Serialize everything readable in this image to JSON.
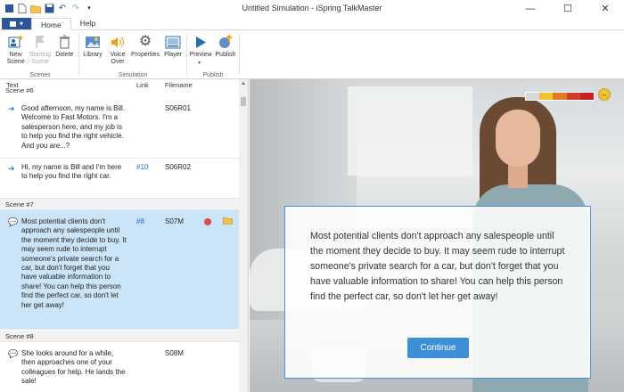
{
  "window": {
    "title": "Untitled Simulation - iSpring TalkMaster",
    "minimize": "—",
    "maximize": "☐",
    "close": "✕"
  },
  "quick_access": {
    "app_button": "▾"
  },
  "tabs": [
    {
      "label": "Home",
      "active": true
    },
    {
      "label": "Help",
      "active": false
    }
  ],
  "ribbon": {
    "groups": [
      {
        "label": "Scenes",
        "buttons": [
          {
            "label": "New\nScene",
            "icon": "new-scene-icon"
          },
          {
            "label": "Starting\nScene",
            "icon": "flag-icon",
            "disabled": true
          },
          {
            "label": "Delete",
            "icon": "trash-icon"
          }
        ]
      },
      {
        "label": "Simulation",
        "buttons": [
          {
            "label": "Library",
            "icon": "library-icon"
          },
          {
            "label": "Voice\nOver",
            "icon": "speaker-icon"
          },
          {
            "label": "Properties",
            "icon": "gear-icon"
          },
          {
            "label": "Player",
            "icon": "player-icon"
          }
        ]
      },
      {
        "label": "Publish",
        "buttons": [
          {
            "label": "Preview",
            "icon": "play-icon"
          },
          {
            "label": "Publish",
            "icon": "publish-icon"
          }
        ]
      }
    ]
  },
  "scene_list": {
    "columns": {
      "text": "Text",
      "link": "Link",
      "filename": "Filename"
    },
    "partial_header": "Scene #6",
    "rows_scene6": [
      {
        "text": "Good afternoon, my name is Bill. Welcome to Fast Motors. I'm a salesperson here, and my job is to help you find the right vehicle. And you are...?",
        "link": "",
        "filename": "S06R01"
      },
      {
        "text": "Hi, my name is Bill and I'm here to help you find the right car.",
        "link": "#10",
        "filename": "S06R02"
      }
    ],
    "scene7_header": "Scene #7",
    "row_scene7": {
      "text": "Most potential clients don't approach any salespeople until the moment they decide to buy. It may seem rude to interrupt someone's private search for a car, but don't forget that you have valuable information to share! You can help this person find the perfect car, so don't let her get away!",
      "link": "#8",
      "filename": "S07M"
    },
    "scene8_header": "Scene #8",
    "row_scene8": {
      "text": "She looks around for a while, then approaches one of your colleagues for help. He lands the sale!",
      "link": "",
      "filename": "S08M"
    }
  },
  "preview": {
    "message": "Most potential clients don't approach any salespeople until the moment they decide to buy. It may seem rude to interrupt someone's private search for a car, but don't forget that you have valuable information to share! You can help this person find the perfect car, so don't let her get away!",
    "continue_label": "Continue",
    "mood_colors": [
      "#d8d8d8",
      "#f2c12e",
      "#e07b23",
      "#d23a2a",
      "#c42323"
    ],
    "accent": "#3d8fd6"
  }
}
